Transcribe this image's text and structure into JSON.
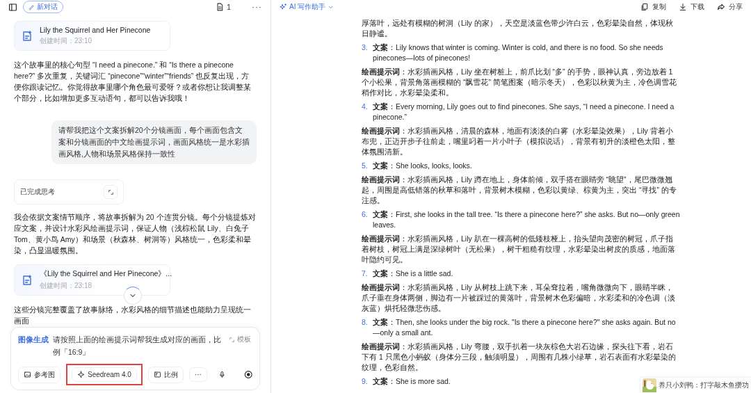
{
  "chat": {
    "toolbar": {
      "new_chat": "新对话",
      "doc_count": "1",
      "more": "···"
    },
    "messages": [
      {
        "kind": "doc",
        "title": "Lily the Squirrel and Her Pinecone",
        "meta": "创建时间：23:10"
      },
      {
        "kind": "assistant",
        "text": "这个故事里的核心句型 “I need a pinecone.” 和 “Is there a pinecone here?” 多次重复，关键词汇 “pinecone”“winter”“friends” 也反复出现，方便你跟读记忆。你觉得故事里哪个角色最可爱呀？或者你想让我调整某个部分，比如增加更多互动语句，都可以告诉我哦！"
      },
      {
        "kind": "user",
        "text": "请帮我把这个文案拆解20个分镜画面，每个画面包含文案和分镜画面的中文绘画提示词，画面风格统一是水彩插画风格,人物和场景风格保持一致性"
      },
      {
        "kind": "thinking",
        "text": "已完成思考"
      },
      {
        "kind": "assistant",
        "text": "我会依据文案情节顺序，将故事拆解为 20 个连贯分镜。每个分镜提炼对应文案，并设计水彩风绘画提示词，保证人物（浅棕松鼠 Lily、白兔子 Tom、黄小鸟 Amy）和场景（秋森林、树洞等）风格统一，色彩柔和晕染，凸显温暖氛围。"
      },
      {
        "kind": "doc",
        "title": "《Lily the Squirrel and Her Pinecone》...",
        "meta": "创建时间：23:18"
      },
      {
        "kind": "assistant",
        "text": "这些分镜完整覆盖了故事脉络，水彩风格的细节描述也能助力呈现统一画面"
      }
    ],
    "input": {
      "tag": "图像生成",
      "text": "请按照上面的绘画提示词帮我生成对应的画面，比例「16:9」",
      "template": "模板",
      "tools": [
        {
          "kind": "reference",
          "label": "参考图",
          "highlighted": false
        },
        {
          "kind": "model",
          "label": "Seedream 4.0",
          "highlighted": true
        },
        {
          "kind": "ratio",
          "label": "比例",
          "highlighted": false
        },
        {
          "kind": "more",
          "label": "···",
          "highlighted": false
        }
      ]
    }
  },
  "document": {
    "assistant": "AI 写作助手",
    "actions": [
      {
        "kind": "copy",
        "label": "复制"
      },
      {
        "kind": "download",
        "label": "下载"
      },
      {
        "kind": "share",
        "label": "分享"
      }
    ],
    "blocks": [
      {
        "kind": "text",
        "text": "厚落叶，远处有模糊的树洞（Lily 的家），天空是淡蓝色带少许白云，色彩晕染自然，体现秋日静谧。"
      },
      {
        "kind": "item",
        "number": "3.",
        "text": "**文案**：Lily knows that winter is coming. Winter is cold, and there is no food. So she needs pinecones—lots of pinecones!"
      },
      {
        "kind": "prompt",
        "text": "**绘画提示词**：水彩插画风格，Lily 坐在树桩上，前爪比划 “多” 的手势，眼神认真，旁边放着 1 个小松果，背景角落画模糊的 “飘雪花” 简笔图案（暗示冬天），色彩以秋黄为主，冷色调雪花稍作对比，水彩晕染柔和。"
      },
      {
        "kind": "item",
        "number": "4.",
        "text": "**文案**：Every morning, Lily goes out to find pinecones. She says, “I need a pinecone. I need a pinecone.”"
      },
      {
        "kind": "prompt",
        "text": "**绘画提示词**：水彩插画风格，清晨的森林，地面有淡淡的白雾（水彩晕染效果），Lily 背着小布兜，正迈开步子往前走，嘴里叼着一片小叶子（模拟说话），背景有初升的淡橙色太阳，整体氛围清新。"
      },
      {
        "kind": "item",
        "number": "5.",
        "text": "**文案**：She looks, looks, looks."
      },
      {
        "kind": "prompt",
        "text": "**绘画提示词**：水彩插画风格，Lily 蹲在地上，身体前倾，双手搭在眼睛旁 “眺望”，尾巴微微翘起，周围是高低错落的秋草和落叶，背景树木模糊，色彩以黄绿、棕黄为主，突出 “寻找” 的专注感。"
      },
      {
        "kind": "item",
        "number": "6.",
        "text": "**文案**：First, she looks in the tall tree. “Is there a pinecone here?” she asks. But no—only green leaves."
      },
      {
        "kind": "prompt",
        "text": "**绘画提示词**：水彩插画风格，Lily 趴在一棵高树的低矮枝桠上，抬头望向茂密的树冠，爪子指着树枝，树冠上满是深绿树叶（无松果），树干粗糙有纹理，水彩晕染出树皮的质感，地面落叶隐约可见。"
      },
      {
        "kind": "item",
        "number": "7.",
        "text": "**文案**：She is a little sad."
      },
      {
        "kind": "prompt",
        "text": "**绘画提示词**：水彩插画风格，Lily 从树枝上跳下来，耳朵耷拉着，嘴角微微向下，眼睛半眯，爪子垂在身体两侧，脚边有一片被踩过的黄落叶，背景树木色彩偏暗，水彩柔和的冷色调（淡灰蓝）烘托轻微悲伤感。"
      },
      {
        "kind": "item",
        "number": "8.",
        "text": "**文案**：Then, she looks under the big rock. \"Is there a pinecone here?\" she asks again. But no—only a small ant."
      },
      {
        "kind": "prompt",
        "text": "**绘画提示词**：水彩插画风格，Lily 弯腰，双手扒着一块灰棕色大岩石边缘，探头往下看，岩石下有 1 只黑色小蚂蚁（身体分三段，触须明显），周围有几株小绿草，岩石表面有水彩晕染的纹理，色彩自然。"
      },
      {
        "kind": "item",
        "number": "9.",
        "text": "**文案**：She is more sad."
      }
    ]
  },
  "notification": {
    "text": "养只小刘鸭：打字敲木鱼攒功"
  }
}
